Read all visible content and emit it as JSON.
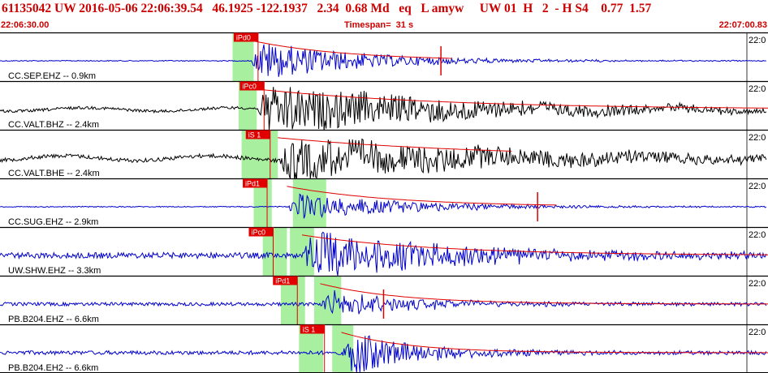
{
  "header": {
    "title": "61135042 UW 2016-05-06 22:06:39.54   46.1925 -122.1937   2.34  0.68 Md   eq   L amyw     UW 01  H   2  - H S4    0.77  1.57",
    "start_time": "22:06:30.00",
    "timespan": "Timespan=  31 s",
    "end_time": "22:07:00.83"
  },
  "colors": {
    "header_red": "#cc0000",
    "trace_blue": "#0000cc",
    "trace_black": "#000000",
    "pick_red": "#e00000",
    "window_green": "#a8f0a0"
  },
  "tick_label": "22:0",
  "traces": [
    {
      "label": "CC.SEP.EHZ -- 0.9km",
      "color": "blue",
      "pick": "iPd0",
      "pick_time": 7.9,
      "green": [
        [
          7.7,
          8.4
        ]
      ],
      "onset": 8.3,
      "amp": 0.45,
      "noise": 0.02,
      "decay": 3.5,
      "coda_end": 15.0,
      "spike": 14.6
    },
    {
      "label": "CC.VALT.BHZ -- 2.4km",
      "color": "black",
      "pick": "iPc0",
      "pick_time": 8.1,
      "green": [
        [
          7.9,
          8.5
        ]
      ],
      "onset": 8.5,
      "amp": 0.55,
      "noise": 0.06,
      "decay": 7.0,
      "coda_end": 31.0,
      "spike": null
    },
    {
      "label": "CC.VALT.BHE -- 2.4km",
      "color": "black",
      "pick": "iS 1",
      "pick_time": 8.3,
      "green": [
        [
          8.0,
          9.2
        ]
      ],
      "onset": 9.2,
      "amp": 0.5,
      "noise": 0.08,
      "decay": 8.0,
      "coda_end": 17.0,
      "spike": null
    },
    {
      "label": "CC.SUG.EHZ -- 2.9km",
      "color": "blue",
      "pick": "iPd1",
      "pick_time": 8.2,
      "green": [
        [
          8.4,
          9.0
        ],
        [
          9.7,
          10.8
        ]
      ],
      "onset": 9.5,
      "amp": 0.3,
      "noise": 0.02,
      "decay": 4.0,
      "coda_end": 18.5,
      "spike": 17.8
    },
    {
      "label": "UW.SHW.EHZ -- 3.3km",
      "color": "blue",
      "pick": "iPc0",
      "pick_time": 8.4,
      "green": [
        [
          8.7,
          9.5
        ],
        [
          9.6,
          10.4
        ]
      ],
      "onset": 10.0,
      "amp": 0.55,
      "noise": 0.12,
      "decay": 5.0,
      "coda_end": 31.0,
      "spike": null
    },
    {
      "label": "PB.B204.EHZ -- 6.6km",
      "color": "blue",
      "pick": "iPd1",
      "pick_time": 9.2,
      "green": [
        [
          9.3,
          10.1
        ],
        [
          10.4,
          11.3
        ]
      ],
      "onset": 10.6,
      "amp": 0.3,
      "noise": 0.07,
      "decay": 3.0,
      "coda_end": 31.0,
      "spike": 12.7
    },
    {
      "label": "PB.B204.EH2 -- 6.6km",
      "color": "blue",
      "pick": "iS 1",
      "pick_time": 10.1,
      "green": [
        [
          9.9,
          10.7
        ],
        [
          11.0,
          11.7
        ]
      ],
      "onset": 11.3,
      "amp": 0.5,
      "noise": 0.08,
      "decay": 2.5,
      "coda_end": 31.0,
      "spike": null
    }
  ]
}
